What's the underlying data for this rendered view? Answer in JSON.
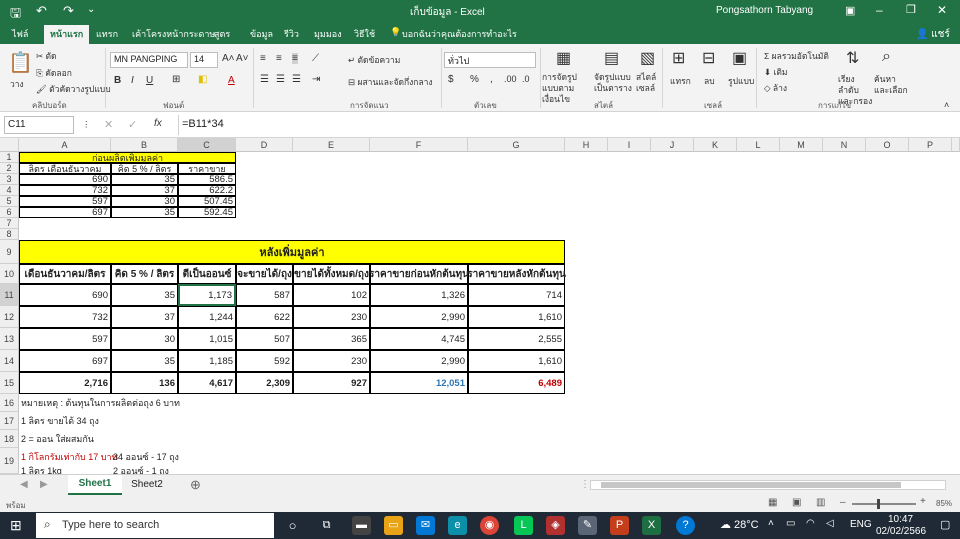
{
  "window": {
    "title": "เก็บข้อมูล  -  Excel",
    "user": "Pongsathorn Tabyang",
    "share": "แชร์"
  },
  "ribbon_tabs": [
    "ไฟล์",
    "หน้าแรก",
    "แทรก",
    "เค้าโครงหน้ากระดาษ",
    "สูตร",
    "ข้อมูล",
    "รีวิว",
    "มุมมอง",
    "วิธีใช้",
    "บอกฉันว่าคุณต้องการทำอะไร"
  ],
  "clipboard": {
    "paste": "วาง",
    "cut": "ตัด",
    "copy": "คัดลอก",
    "format_painter": "ตัวคัดวางรูปแบบ",
    "label": "คลิปบอร์ด"
  },
  "font": {
    "name": "MN PANGPING",
    "size": "14",
    "label": "ฟอนต์"
  },
  "alignment": {
    "wrap": "ตัดข้อความ",
    "merge": "ผสานและจัดกึ่งกลาง",
    "label": "การจัดแนว"
  },
  "number": {
    "format": "ทั่วไป",
    "label": "ตัวเลข"
  },
  "styles": {
    "conditional": "การจัดรูปแบบตามเงื่อนไข",
    "format_table": "จัดรูปแบบเป็นตาราง",
    "cell_styles": "สไตล์เซลล์",
    "label": "สไตล์"
  },
  "cells": {
    "insert": "แทรก",
    "delete": "ลบ",
    "format": "รูปแบบ",
    "label": "เซลล์"
  },
  "editing": {
    "autosum": "ผลรวมอัตโนมัติ",
    "fill": "เติม",
    "clear": "ล้าง",
    "sort": "เรียงลำดับและกรอง",
    "find": "ค้นหาและเลือก",
    "label": "การแก้ไข"
  },
  "formula_bar": {
    "name_box": "C11",
    "fx": "fx",
    "formula": "=B11*34"
  },
  "columns": [
    "A",
    "B",
    "C",
    "D",
    "E",
    "F",
    "G",
    "H",
    "I",
    "J",
    "K",
    "L",
    "M",
    "N",
    "O",
    "P"
  ],
  "rows": [
    "1",
    "2",
    "3",
    "4",
    "5",
    "6",
    "7",
    "8",
    "9",
    "10",
    "11",
    "12",
    "13",
    "14",
    "15",
    "16",
    "17",
    "18",
    "19"
  ],
  "table1": {
    "title": "ก่อนผลิตเพิ่มมูลค่า",
    "headers": [
      "ลิตร เดือนธันวาคม",
      "คิด 5 % / ลิตร",
      "ราคาขาย"
    ],
    "rows": [
      [
        "690",
        "35",
        "586.5"
      ],
      [
        "732",
        "37",
        "622.2"
      ],
      [
        "597",
        "30",
        "507.45"
      ],
      [
        "697",
        "35",
        "592.45"
      ]
    ]
  },
  "table2": {
    "title": "หลังเพิ่มมูลค่า",
    "headers": [
      "เดือนธันวาคม/ลิตร",
      "คิด 5 % / ลิตร",
      "ตีเป็นออนซ์",
      "จะขายได้/ถุง",
      "ขายได้ทั้งหมด/ถุง",
      "ราคาขายก่อนหักต้นทุน",
      "ราคาขายหลังหักต้นทุน"
    ],
    "rows": [
      [
        "690",
        "35",
        "1,173",
        "587",
        "102",
        "1,326",
        "714"
      ],
      [
        "732",
        "37",
        "1,244",
        "622",
        "230",
        "2,990",
        "1,610"
      ],
      [
        "597",
        "30",
        "1,015",
        "507",
        "365",
        "4,745",
        "2,555"
      ],
      [
        "697",
        "35",
        "1,185",
        "592",
        "230",
        "2,990",
        "1,610"
      ]
    ],
    "totals": [
      "2,716",
      "136",
      "4,617",
      "2,309",
      "927",
      "12,051",
      "6,489"
    ],
    "total_f_color": "#2e75b6",
    "total_g_color": "#c00000"
  },
  "notes": [
    "หมายเหตุ : ต้นทุนในการผลิตต่อถุง 6 บาท",
    "1 ลิตร ขายได้ 34 ถุง",
    "2 = ออน ใส่ผสมกัน",
    "1 กิโลกรัมเท่ากับ 17 บาท",
    "34 ออนซ์ - 17 ถุง",
    "1 ลิตร 1kg",
    "2 ออนซ์ - 1 ถุง"
  ],
  "note_red_color": "#c00000",
  "sheets": [
    "Sheet1",
    "Sheet2"
  ],
  "status": {
    "mode": "พร้อม",
    "zoom": "85%"
  },
  "taskbar": {
    "search": "Type here to search",
    "weather": "28°C",
    "lang": "ENG",
    "time": "10:47",
    "date": "02/02/2566"
  },
  "accent": "#217346",
  "yellow": "#ffff00"
}
